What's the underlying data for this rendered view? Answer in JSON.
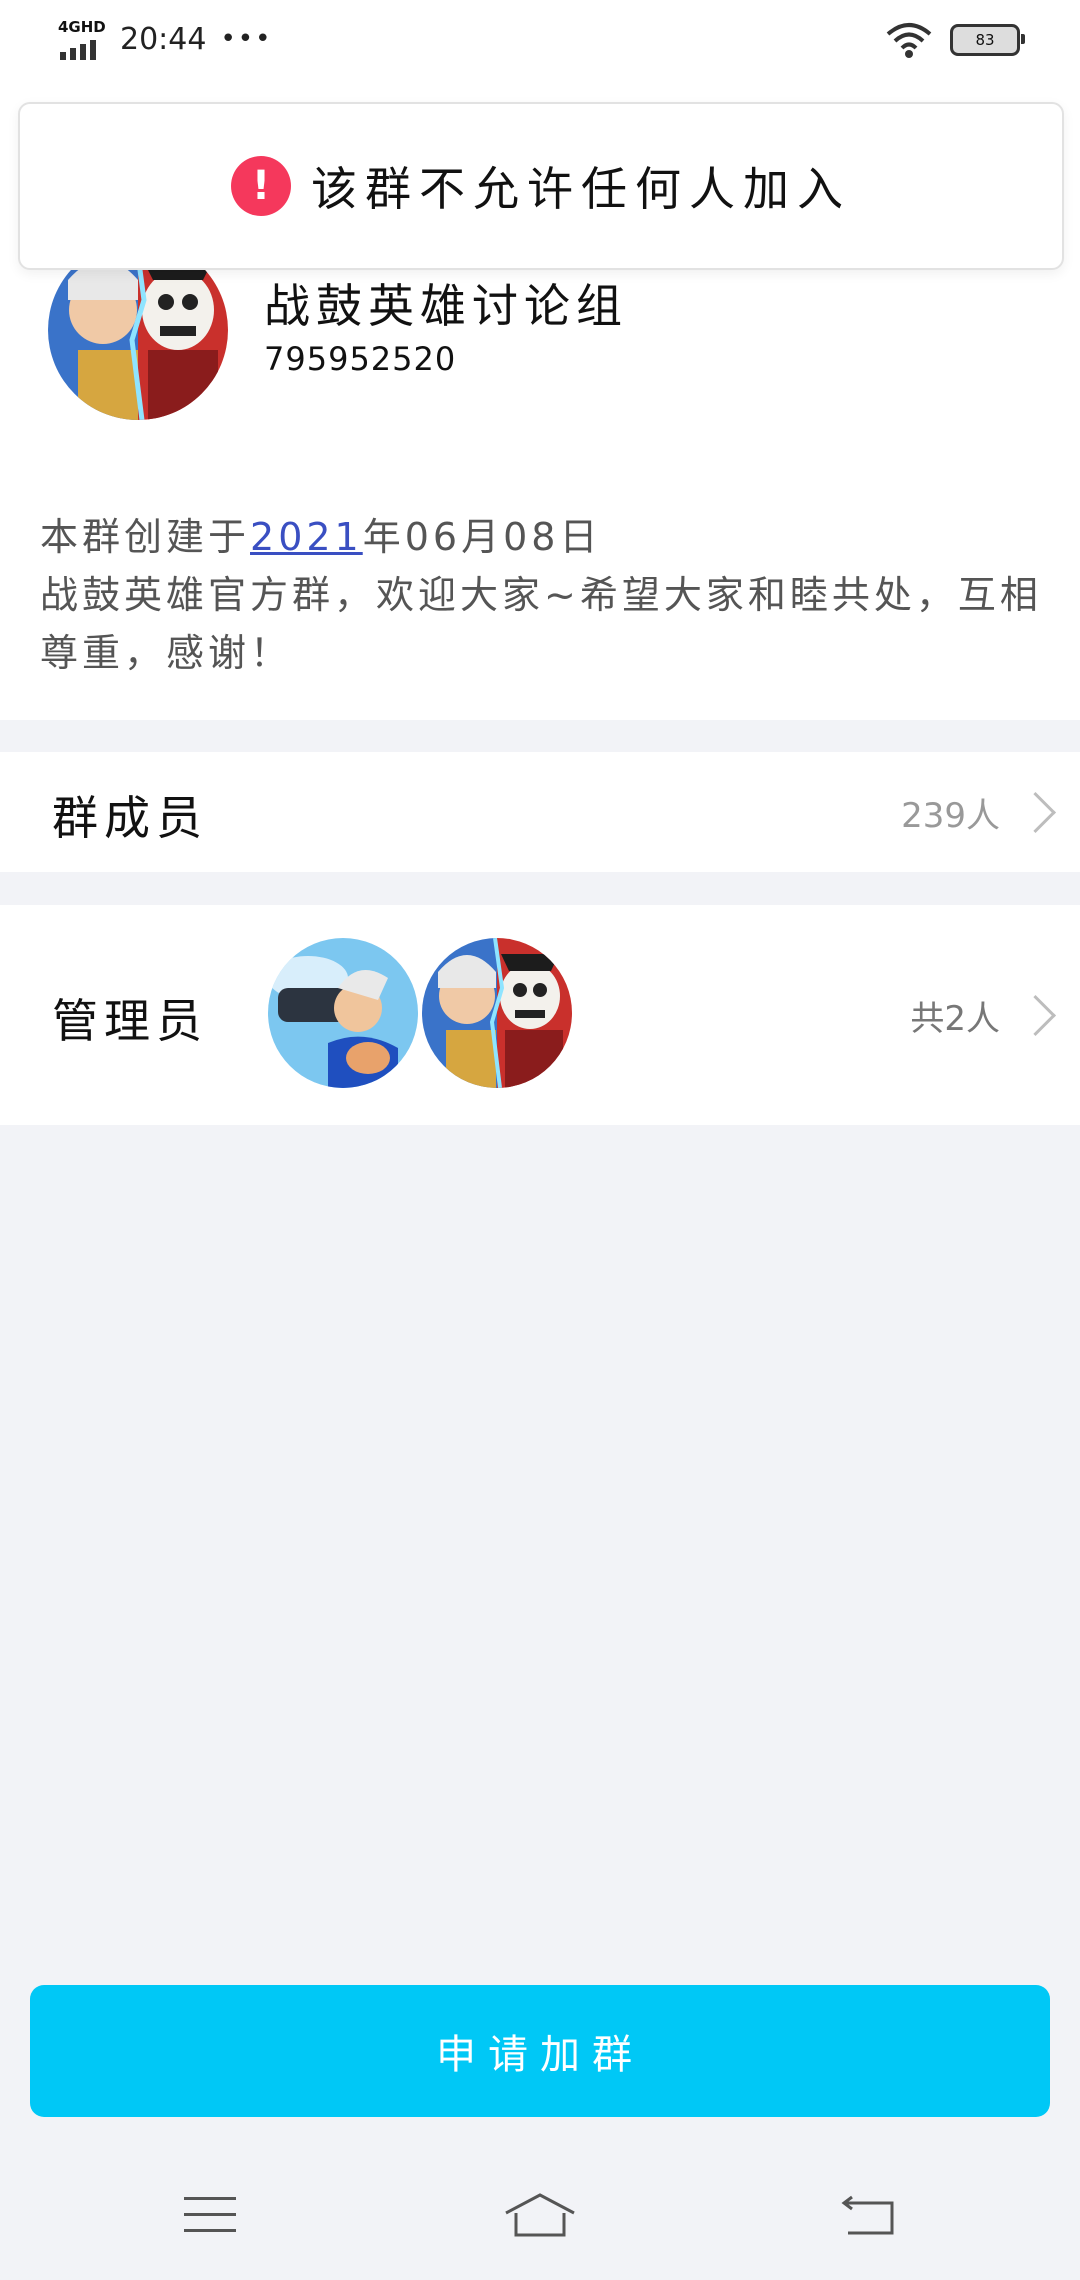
{
  "status_bar": {
    "network": "4GHD",
    "time": "20:44",
    "more": "•••",
    "battery": "83"
  },
  "toast": {
    "icon": "!",
    "message": "该群不允许任何人加入"
  },
  "group": {
    "name": "战鼓英雄讨论组",
    "id": "795952520",
    "created_prefix": "本群创建于",
    "created_year": "2021",
    "created_suffix": "年06月08日",
    "description": "战鼓英雄官方群，欢迎大家~希望大家和睦共处，互相尊重，感谢！"
  },
  "members": {
    "label": "群成员",
    "count": "239人"
  },
  "admins": {
    "label": "管理员",
    "count": "共2人"
  },
  "join_button": {
    "label": "申请加群"
  },
  "colors": {
    "accent": "#00c8f6",
    "warning": "#f5385c",
    "link": "#3a4fc2",
    "background": "#f2f3f7"
  },
  "icons": {
    "signal": "signal-icon",
    "wifi": "wifi-icon",
    "battery": "battery-icon",
    "warning": "warning-icon",
    "chevron": "chevron-right-icon",
    "menu": "menu-icon",
    "home": "home-icon",
    "back": "back-icon"
  }
}
